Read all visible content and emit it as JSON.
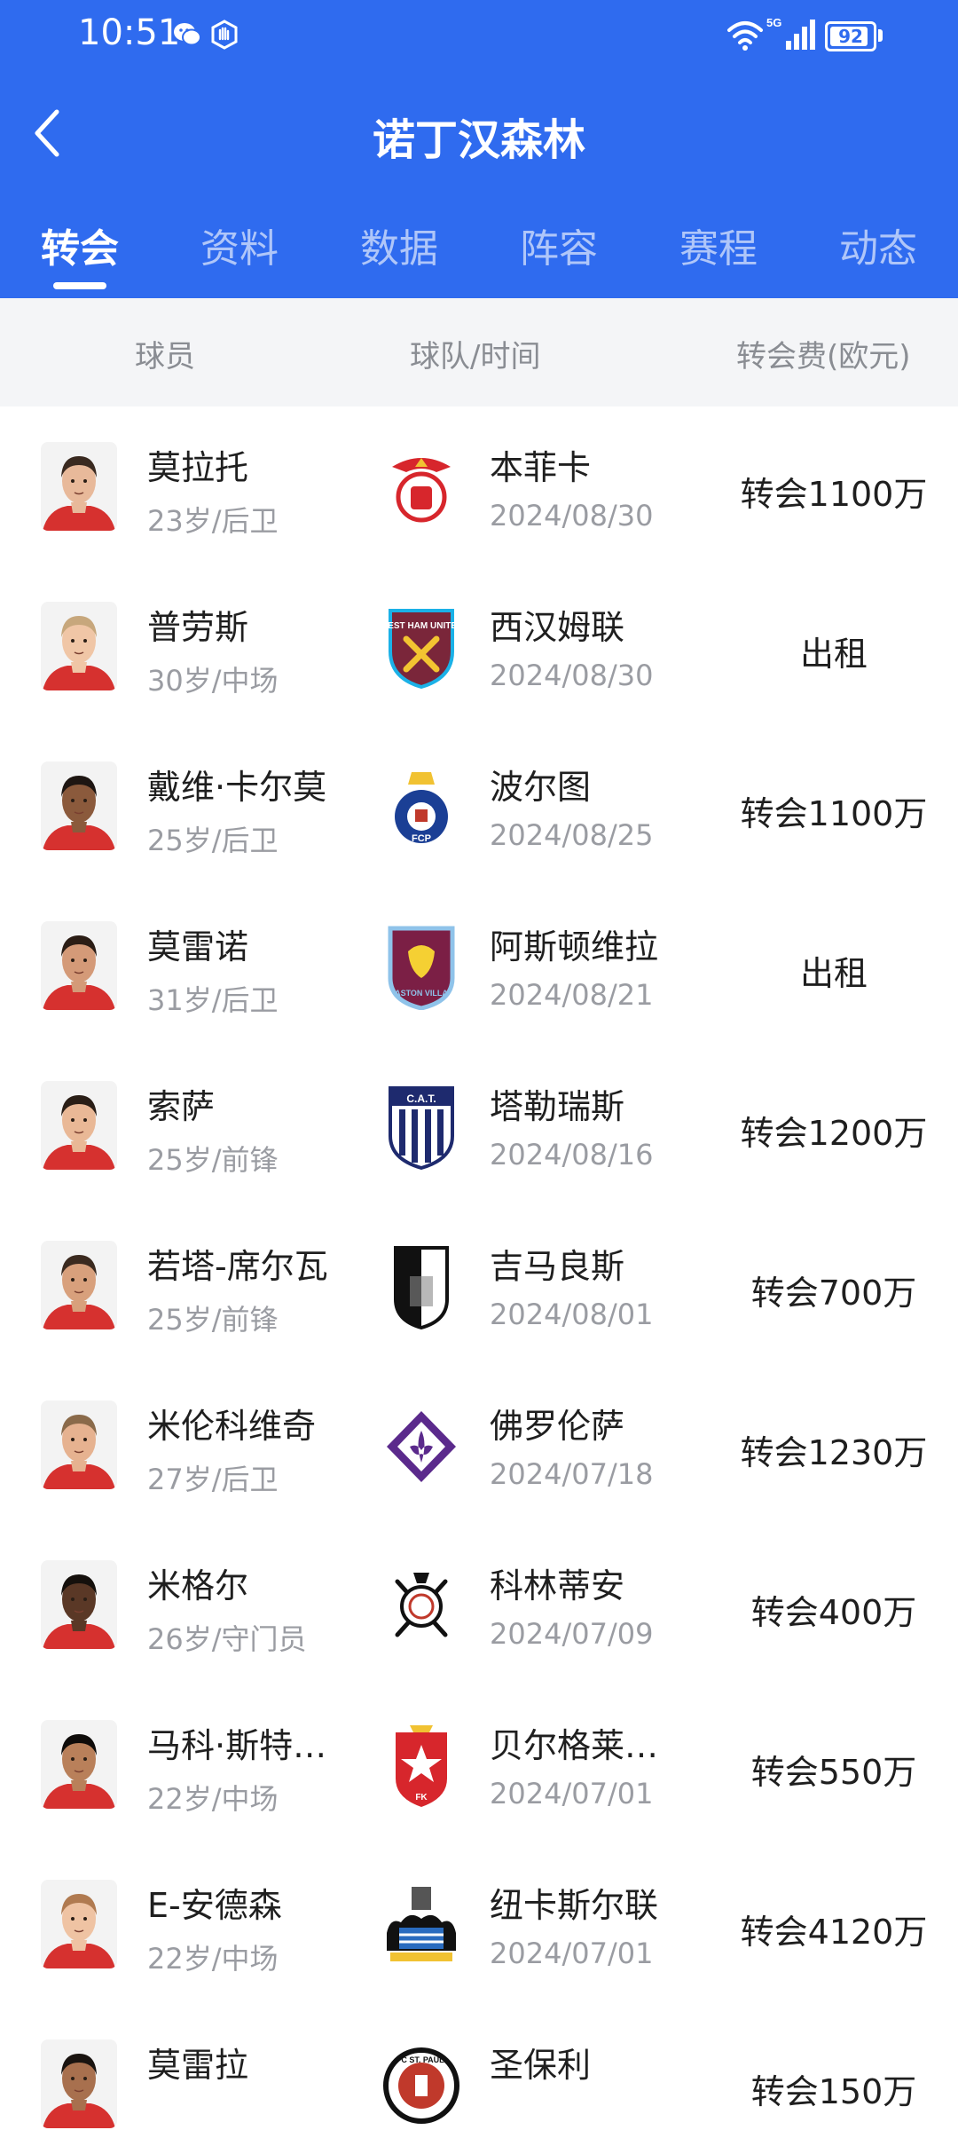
{
  "status_bar": {
    "time": "10:51",
    "battery": "92",
    "battery_level": 0.92
  },
  "header": {
    "title": "诺丁汉森林"
  },
  "tabs": [
    {
      "label": "转会",
      "active": true
    },
    {
      "label": "资料",
      "active": false
    },
    {
      "label": "数据",
      "active": false
    },
    {
      "label": "阵容",
      "active": false
    },
    {
      "label": "赛程",
      "active": false
    },
    {
      "label": "动态",
      "active": false
    }
  ],
  "columns": {
    "player": "球员",
    "team_time": "球队/时间",
    "fee": "转会费(欧元)"
  },
  "transfers": [
    {
      "name": "莫拉托",
      "info": "23岁/后卫",
      "team": "本菲卡",
      "date": "2024/08/30",
      "fee": "转会1100万",
      "team_icon": "benfica-crest-icon"
    },
    {
      "name": "普劳斯",
      "info": "30岁/中场",
      "team": "西汉姆联",
      "date": "2024/08/30",
      "fee": "出租",
      "team_icon": "west-ham-crest-icon",
      "crest_text": "WEST HAM UNITED"
    },
    {
      "name": "戴维·卡尔莫",
      "info": "25岁/后卫",
      "team": "波尔图",
      "date": "2024/08/25",
      "fee": "转会1100万",
      "team_icon": "porto-crest-icon",
      "crest_text": "FCP"
    },
    {
      "name": "莫雷诺",
      "info": "31岁/后卫",
      "team": "阿斯顿维拉",
      "date": "2024/08/21",
      "fee": "出租",
      "team_icon": "aston-villa-crest-icon",
      "crest_text": "ASTON VILLA"
    },
    {
      "name": "索萨",
      "info": "25岁/前锋",
      "team": "塔勒瑞斯",
      "date": "2024/08/16",
      "fee": "转会1200万",
      "team_icon": "talleres-crest-icon",
      "crest_text": "C.A.T."
    },
    {
      "name": "若塔-席尔瓦",
      "info": "25岁/前锋",
      "team": "吉马良斯",
      "date": "2024/08/01",
      "fee": "转会700万",
      "team_icon": "guimaraes-crest-icon"
    },
    {
      "name": "米伦科维奇",
      "info": "27岁/后卫",
      "team": "佛罗伦萨",
      "date": "2024/07/18",
      "fee": "转会1230万",
      "team_icon": "fiorentina-crest-icon"
    },
    {
      "name": "米格尔",
      "info": "26岁/守门员",
      "team": "科林蒂安",
      "date": "2024/07/09",
      "fee": "转会400万",
      "team_icon": "corinthians-crest-icon"
    },
    {
      "name": "马科·斯特罗夫",
      "info": "22岁/中场",
      "team": "贝尔格莱德红星",
      "date": "2024/07/01",
      "fee": "转会550万",
      "team_icon": "red-star-crest-icon",
      "crest_text": "FK"
    },
    {
      "name": "E-安德森",
      "info": "22岁/中场",
      "team": "纽卡斯尔联",
      "date": "2024/07/01",
      "fee": "转会4120万",
      "team_icon": "newcastle-crest-icon"
    },
    {
      "name": "莫雷拉",
      "info": "",
      "team": "圣保利",
      "date": "",
      "fee": "转会150万",
      "team_icon": "st-pauli-crest-icon",
      "crest_text": "FC ST. PAULI"
    }
  ],
  "colors": {
    "primary": "#2f6bef",
    "text": "#1f1f1f",
    "muted": "#9a9ca2",
    "column_header_bg": "#f4f5f7"
  }
}
